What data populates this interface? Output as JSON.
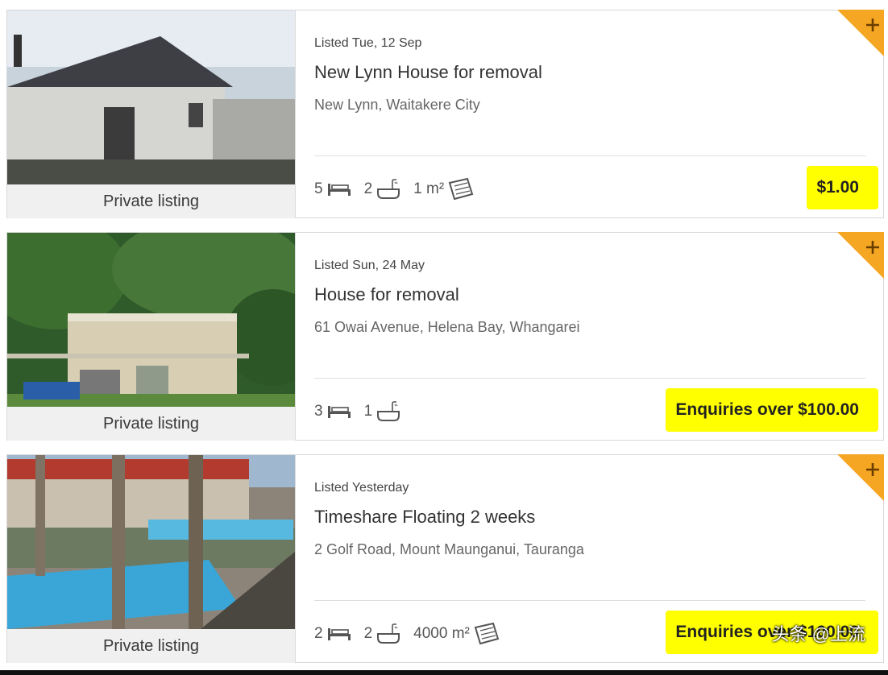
{
  "listings": [
    {
      "listed": "Listed Tue, 12 Sep",
      "title": "New Lynn House for removal",
      "location": "New Lynn, Waitakere City",
      "bedrooms": "5",
      "bathrooms": "2",
      "area": "1 m²",
      "price": "$1.00",
      "badge": "Private listing",
      "photo_icon": "house-photo"
    },
    {
      "listed": "Listed Sun, 24 May",
      "title": "House for removal",
      "location": "61 Owai Avenue, Helena Bay, Whangarei",
      "bedrooms": "3",
      "bathrooms": "1",
      "price": "Enquiries over $100.00",
      "badge": "Private listing",
      "photo_icon": "house-photo"
    },
    {
      "listed": "Listed Yesterday",
      "title": "Timeshare Floating 2 weeks",
      "location": "2 Golf Road, Mount Maunganui, Tauranga",
      "bedrooms": "2",
      "bathrooms": "2",
      "area": "4000 m²",
      "price": "Enquiries over $100.00",
      "badge": "Private listing",
      "photo_icon": "pool-photo"
    }
  ],
  "watermark": "头条 @上流",
  "colors": {
    "accent": "#f5a623",
    "highlight": "#ffff00"
  }
}
